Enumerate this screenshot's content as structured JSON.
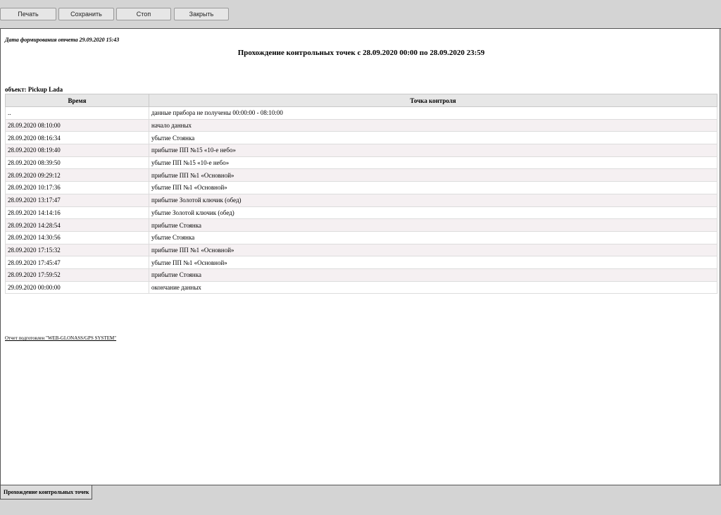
{
  "toolbar": {
    "print_label": "Печать",
    "save_label": "Сохранить",
    "stop_label": "Стоп",
    "close_label": "Закрыть"
  },
  "report": {
    "generated": "Дата формирования отчета 29.09.2020 15:43",
    "title": "Прохождение контрольных точек с 28.09.2020 00:00 по 28.09.2020 23:59",
    "object": "объект: Pickup Lada",
    "columns": [
      "Время",
      "Точка контроля"
    ],
    "rows": [
      {
        "time": "..",
        "point": "данные прибора не получены 00:00:00 - 08:10:00"
      },
      {
        "time": "28.09.2020 08:10:00",
        "point": "начало данных"
      },
      {
        "time": "28.09.2020 08:16:34",
        "point": "убытие Стоянка"
      },
      {
        "time": "28.09.2020 08:19:40",
        "point": "прибытие ПП №15 «10-е небо»"
      },
      {
        "time": "28.09.2020 08:39:50",
        "point": "убытие ПП №15 «10-е небо»"
      },
      {
        "time": "28.09.2020 09:29:12",
        "point": "прибытие ПП №1 «Основной»"
      },
      {
        "time": "28.09.2020 10:17:36",
        "point": "убытие ПП №1 «Основной»"
      },
      {
        "time": "28.09.2020 13:17:47",
        "point": "прибытие Золотой ключик (обед)"
      },
      {
        "time": "28.09.2020 14:14:16",
        "point": "убытие Золотой ключик (обед)"
      },
      {
        "time": "28.09.2020 14:28:54",
        "point": "прибытие Стоянка"
      },
      {
        "time": "28.09.2020 14:30:56",
        "point": "убытие Стоянка"
      },
      {
        "time": "28.09.2020 17:15:32",
        "point": "прибытие ПП №1 «Основной»"
      },
      {
        "time": "28.09.2020 17:45:47",
        "point": "убытие ПП №1 «Основной»"
      },
      {
        "time": "28.09.2020 17:59:52",
        "point": "прибытие Стоянка"
      },
      {
        "time": "29.09.2020 00:00:00",
        "point": "окончание данных"
      }
    ],
    "footer": "Отчет подготовлен \"WEB-GLONASS/GPS SYSTEM\""
  },
  "bottom": {
    "tab_label": "Прохождение контрольных точек"
  },
  "colors": {
    "chrome": "#d4d4d4",
    "row_alt": "#f5f0f2",
    "header_bg": "#e7e7e7"
  }
}
